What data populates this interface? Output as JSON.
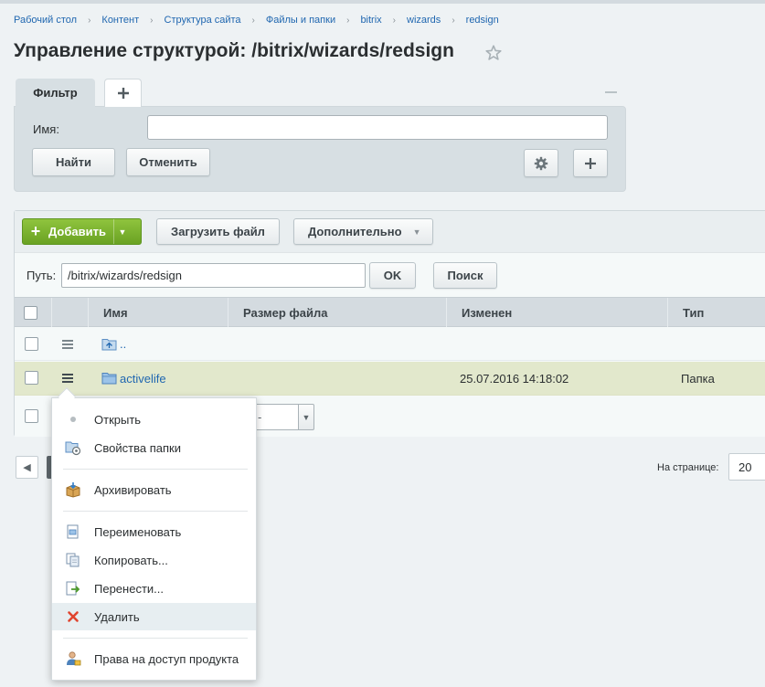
{
  "breadcrumb": [
    "Рабочий стол",
    "Контент",
    "Структура сайта",
    "Файлы и папки",
    "bitrix",
    "wizards",
    "redsign"
  ],
  "title": "Управление структурой: /bitrix/wizards/redsign",
  "filter": {
    "tab_label": "Фильтр",
    "name_label": "Имя:",
    "name_value": "",
    "find_label": "Найти",
    "cancel_label": "Отменить"
  },
  "toolbar": {
    "add_label": "Добавить",
    "upload_label": "Загрузить файл",
    "more_label": "Дополнительно"
  },
  "path": {
    "label": "Путь:",
    "value": "/bitrix/wizards/redsign",
    "ok_label": "OK",
    "search_label": "Поиск"
  },
  "grid": {
    "columns": [
      "Имя",
      "Размер файла",
      "Изменен",
      "Тип"
    ],
    "rows": [
      {
        "name": "..",
        "size": "",
        "modified": "",
        "type": ""
      },
      {
        "name": "activelife",
        "size": "",
        "modified": "25.07.2016 14:18:02",
        "type": "Папка"
      }
    ],
    "action_select_value": "-"
  },
  "pager": {
    "per_page_label": "На странице:",
    "per_page_value": "20"
  },
  "context_menu": {
    "items": [
      {
        "label": "Открыть",
        "icon": "dot-icon"
      },
      {
        "label": "Свойства папки",
        "icon": "folder-properties-icon"
      },
      {
        "label": "Архивировать",
        "icon": "archive-icon"
      },
      {
        "label": "Переименовать",
        "icon": "rename-icon"
      },
      {
        "label": "Копировать...",
        "icon": "copy-icon"
      },
      {
        "label": "Перенести...",
        "icon": "move-icon"
      },
      {
        "label": "Удалить",
        "icon": "delete-icon"
      },
      {
        "label": "Права на доступ продукта",
        "icon": "access-rights-icon"
      }
    ]
  },
  "colors": {
    "link": "#2067b0",
    "add_button": "#7ab030",
    "selected_row": "#e2e8cc"
  }
}
